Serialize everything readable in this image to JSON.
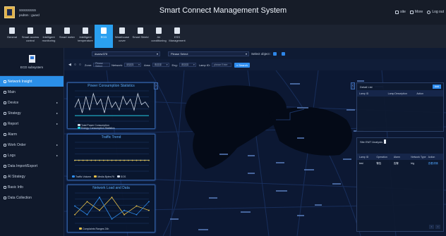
{
  "header": {
    "user_line1": "SSSSSSSS",
    "user_line2": "psd6m : guard",
    "title": "Smart Connect Management System",
    "site_label": "site",
    "more_label": "More",
    "logout_label": "Log out"
  },
  "nav": [
    {
      "label": "General",
      "icon": "general-icon",
      "active": false
    },
    {
      "label": "Smart access control",
      "icon": "access-icon",
      "active": false
    },
    {
      "label": "Intelligent monitoring",
      "icon": "monitor-icon",
      "active": false
    },
    {
      "label": "Smart meter",
      "icon": "meter-icon",
      "active": false
    },
    {
      "label": "Intelligent temperature",
      "icon": "temperature-icon",
      "active": false
    },
    {
      "label": "ECD",
      "icon": "ecd-icon",
      "active": true
    },
    {
      "label": "Warehouse cover",
      "icon": "warehouse-icon",
      "active": false
    },
    {
      "label": "Smart Shield",
      "icon": "shield-icon",
      "active": false
    },
    {
      "label": "Air conditioning",
      "icon": "aircon-icon",
      "active": false
    },
    {
      "label": "ESS Management",
      "icon": "ess-icon",
      "active": false
    }
  ],
  "sidebar": {
    "system_label": "ECD subsystem",
    "items": [
      {
        "label": "Network Insight",
        "icon": "network-icon",
        "active": true,
        "caret": false
      },
      {
        "label": "Main",
        "icon": "home-icon",
        "active": false,
        "caret": false
      },
      {
        "label": "Device",
        "icon": "device-icon",
        "active": false,
        "caret": true
      },
      {
        "label": "Strategy",
        "icon": "strategy-icon",
        "active": false,
        "caret": true
      },
      {
        "label": "Report",
        "icon": "report-icon",
        "active": false,
        "caret": true
      },
      {
        "label": "Alarm",
        "icon": "alarm-icon",
        "active": false,
        "caret": false
      },
      {
        "label": "Work Order",
        "icon": "work-order-icon",
        "active": false,
        "caret": true
      },
      {
        "label": "Logs",
        "icon": "logs-icon",
        "active": false,
        "caret": true
      },
      {
        "label": "Data Import/Export",
        "icon": "data-icon",
        "active": false,
        "caret": false
      },
      {
        "label": "AI Strategy",
        "icon": "ai-icon",
        "active": false,
        "caret": false
      },
      {
        "label": "Basic Info",
        "icon": "info-icon",
        "active": false,
        "caret": false
      },
      {
        "label": "Data Collection",
        "icon": "collection-icon",
        "active": false,
        "caret": false
      }
    ]
  },
  "filters": {
    "region_value": "dsaew378",
    "second_placeholder": "Please Select",
    "select_object_label": "Select object :",
    "zoom_label": "Zone:",
    "zoom_placeholder": "Please Select",
    "network_label": "Network:",
    "network_value": "请选择",
    "area_label": "Area:",
    "area_value": "请选择",
    "eng_label": "Eng:",
    "eng_value": "请选择",
    "lamp_label": "Lamp ID:",
    "lamp_placeholder": "please Enter",
    "search_label": "Search"
  },
  "charts": {
    "panel1": {
      "title": "Power Consumption Statistics",
      "legend": [
        "Total Power Consumption",
        "Energy Consumption Statistics"
      ]
    },
    "panel2": {
      "title": "Traffic Trend",
      "legend": [
        "Traffic Volume",
        "Media Bytes Rt",
        "SOS"
      ]
    },
    "panel3": {
      "title": "Network Load and Data",
      "legend": [
        "Complaints Ranges 24h"
      ]
    }
  },
  "chart_data": [
    {
      "type": "line",
      "title": "Power Consumption Statistics",
      "series": [
        {
          "name": "Total Power Consumption",
          "values": [
            5,
            8,
            3,
            9,
            4,
            10,
            6,
            8,
            3,
            9,
            5,
            7,
            4,
            9,
            6,
            8,
            4,
            10,
            6,
            7,
            5
          ]
        },
        {
          "name": "Energy Consumption Statistics",
          "values": [
            2,
            2,
            2,
            2,
            2,
            2,
            2,
            2,
            2,
            2,
            2,
            2,
            2,
            2,
            2,
            2,
            2,
            2,
            2,
            2,
            2
          ]
        }
      ]
    },
    {
      "type": "line",
      "title": "Traffic Trend",
      "series": [
        {
          "name": "Traffic Volume",
          "values": [
            3,
            3,
            3,
            3,
            3,
            3,
            3,
            3,
            3,
            3,
            3,
            3,
            3,
            3,
            3,
            3,
            3,
            3,
            3
          ]
        },
        {
          "name": "Media Bytes Rt",
          "values": [
            3,
            3,
            3,
            3,
            3,
            3,
            3,
            3,
            3,
            3,
            3,
            3,
            3,
            3,
            3,
            3,
            3,
            3,
            3
          ]
        }
      ]
    },
    {
      "type": "line",
      "title": "Network Load and Data",
      "series": [
        {
          "name": "Complaints Ranges 24h",
          "values": [
            2,
            5,
            3,
            6,
            2,
            4,
            3
          ]
        },
        {
          "name": "",
          "values": [
            4,
            2,
            6,
            1,
            3,
            2,
            5
          ]
        }
      ]
    }
  ],
  "right_top": {
    "title": "Detail List",
    "button": "Add",
    "columns": [
      "Lamp ID",
      "Lamp Description",
      "Action"
    ]
  },
  "right_bottom": {
    "title": "Site EMT Analysis",
    "columns": [
      "Lamp ID",
      "Operation",
      "Alarm",
      "Network Type",
      "Action"
    ],
    "rows": [
      [
        "test",
        "警告",
        "告警",
        "big",
        "查看详情"
      ]
    ]
  },
  "colors": {
    "accent": "#2aa0f0",
    "panel_border": "#2e5796",
    "map_bg": "#0c1833"
  }
}
